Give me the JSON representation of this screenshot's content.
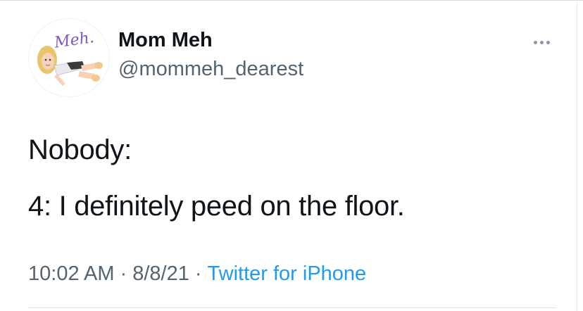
{
  "tweet": {
    "author": {
      "display_name": "Mom Meh",
      "handle": "@mommeh_dearest",
      "avatar_text": "Meh."
    },
    "lines": [
      "Nobody:",
      "4: I definitely peed on the floor."
    ],
    "time": "10:02 AM",
    "date": "8/8/21",
    "separator": "·",
    "source": "Twitter for iPhone"
  },
  "colors": {
    "text": "#0f1419",
    "secondary": "#536471",
    "link": "#1d9bf0",
    "avatar_text": "#7e57c2"
  },
  "icons": [
    "avatar-image",
    "more-options-icon"
  ]
}
